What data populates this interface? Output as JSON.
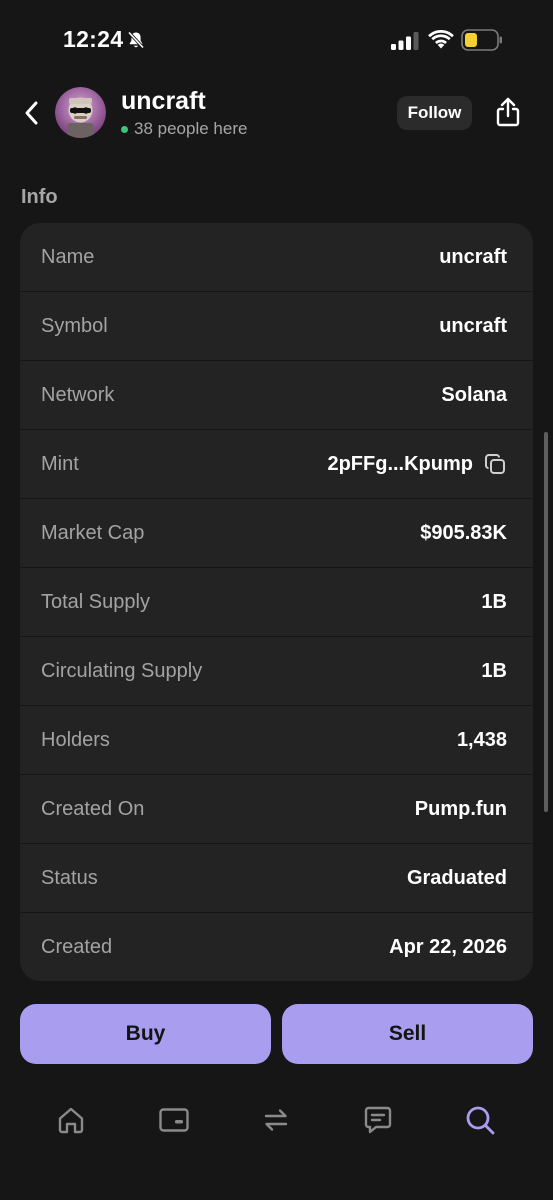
{
  "status_bar": {
    "time": "12:24",
    "icons": [
      "bell-slash-icon",
      "signal-icon",
      "wifi-icon",
      "battery-low-icon"
    ],
    "battery_color": "#f5d033"
  },
  "header": {
    "title": "uncraft",
    "presence_text": "38 people here",
    "presence_color": "#3fc27a",
    "follow_label": "Follow",
    "icons": [
      "chevron-left-icon",
      "share-icon"
    ]
  },
  "info": {
    "heading": "Info",
    "rows": [
      {
        "label": "Name",
        "value": "uncraft"
      },
      {
        "label": "Symbol",
        "value": "uncraft"
      },
      {
        "label": "Network",
        "value": "Solana"
      },
      {
        "label": "Mint",
        "value": "2pFFg...Kpump"
      },
      {
        "label": "Market Cap",
        "value": "$905.83K"
      },
      {
        "label": "Total Supply",
        "value": "1B"
      },
      {
        "label": "Circulating Supply",
        "value": "1B"
      },
      {
        "label": "Holders",
        "value": "1,438"
      },
      {
        "label": "Created On",
        "value": "Pump.fun"
      },
      {
        "label": "Status",
        "value": "Graduated"
      },
      {
        "label": "Created",
        "value": "Apr 22, 2026"
      }
    ]
  },
  "actions": {
    "buy_label": "Buy",
    "sell_label": "Sell",
    "accent_color": "#a99df0"
  },
  "bottom_nav": {
    "items": [
      {
        "icon": "home-icon",
        "active": false
      },
      {
        "icon": "wallet-icon",
        "active": false
      },
      {
        "icon": "swap-icon",
        "active": false
      },
      {
        "icon": "chat-icon",
        "active": false
      },
      {
        "icon": "search-icon",
        "active": true
      }
    ],
    "active_color": "#a99df0",
    "inactive_color": "#8a8a8a"
  }
}
